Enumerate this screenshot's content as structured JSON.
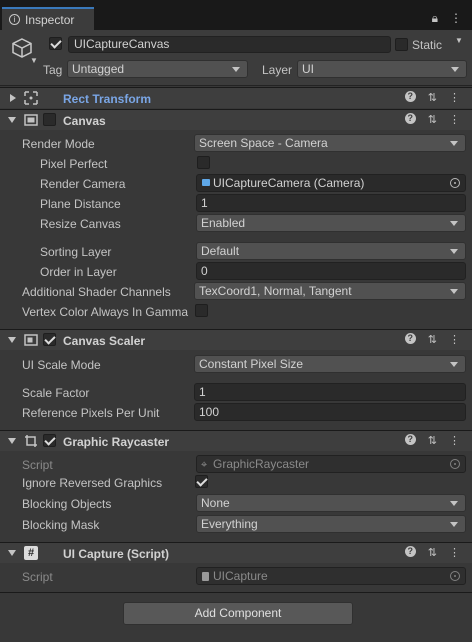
{
  "tab": {
    "title": "Inspector"
  },
  "gameobject": {
    "name": "UICaptureCanvas",
    "static_label": "Static",
    "tag_label": "Tag",
    "tag_value": "Untagged",
    "layer_label": "Layer",
    "layer_value": "UI"
  },
  "components": {
    "rect_transform": {
      "title": "Rect Transform"
    },
    "canvas": {
      "title": "Canvas",
      "render_mode_label": "Render Mode",
      "render_mode_value": "Screen Space - Camera",
      "pixel_perfect_label": "Pixel Perfect",
      "render_camera_label": "Render Camera",
      "render_camera_value": "UICaptureCamera (Camera)",
      "plane_distance_label": "Plane Distance",
      "plane_distance_value": "1",
      "resize_canvas_label": "Resize Canvas",
      "resize_canvas_value": "Enabled",
      "sorting_layer_label": "Sorting Layer",
      "sorting_layer_value": "Default",
      "order_in_layer_label": "Order in Layer",
      "order_in_layer_value": "0",
      "shader_channels_label": "Additional Shader Channels",
      "shader_channels_value": "TexCoord1, Normal, Tangent",
      "vertex_color_label": "Vertex Color Always In Gamma"
    },
    "canvas_scaler": {
      "title": "Canvas Scaler",
      "ui_scale_mode_label": "UI Scale Mode",
      "ui_scale_mode_value": "Constant Pixel Size",
      "scale_factor_label": "Scale Factor",
      "scale_factor_value": "1",
      "ref_ppu_label": "Reference Pixels Per Unit",
      "ref_ppu_value": "100"
    },
    "graphic_raycaster": {
      "title": "Graphic Raycaster",
      "script_label": "Script",
      "script_value": "GraphicRaycaster",
      "ignore_reversed_label": "Ignore Reversed Graphics",
      "blocking_objects_label": "Blocking Objects",
      "blocking_objects_value": "None",
      "blocking_mask_label": "Blocking Mask",
      "blocking_mask_value": "Everything"
    },
    "ui_capture": {
      "title": "UI Capture (Script)",
      "script_label": "Script",
      "script_value": "UICapture"
    }
  },
  "add_component_label": "Add Component"
}
